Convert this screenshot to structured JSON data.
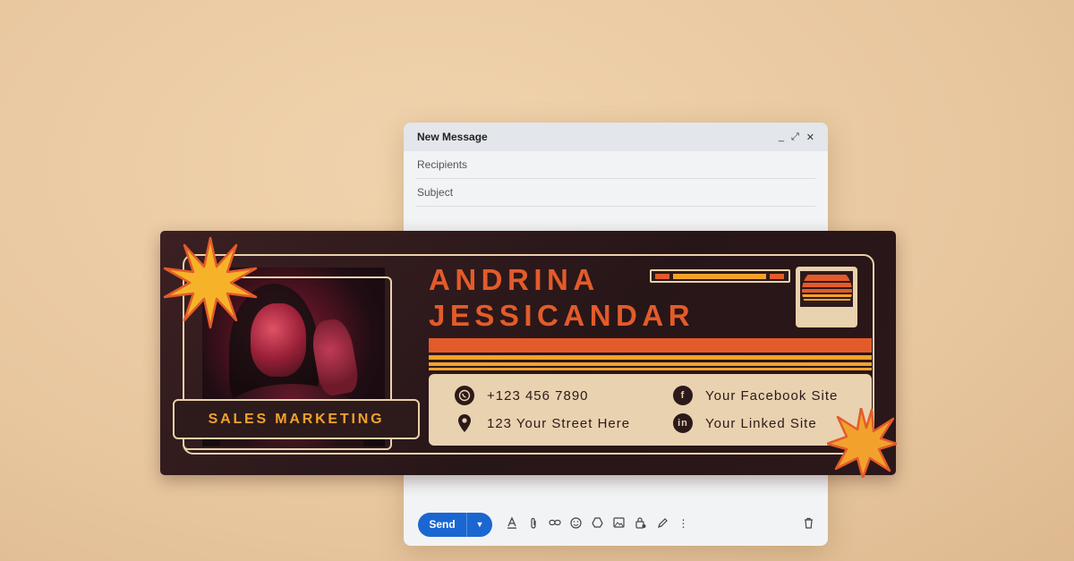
{
  "compose": {
    "title": "New Message",
    "controls": [
      "_",
      "⤢",
      "✕"
    ],
    "recipients_label": "Recipients",
    "subject_label": "Subject",
    "send_label": "Send"
  },
  "signature": {
    "first_name": "ANDRINA",
    "last_name": "JESSICANDAR",
    "job_title": "SALES MARKETING",
    "phone": "+123 456 7890",
    "address": "123 Your Street Here",
    "facebook": "Your Facebook Site",
    "linkedin": "Your Linked Site"
  },
  "colors": {
    "background": "#e9c9a1",
    "banner": "#2b1719",
    "accent_orange": "#e35b2a",
    "accent_gold": "#f2a22c",
    "cream": "#e8d2b0",
    "send_blue": "#1a67d2"
  },
  "icons": {
    "phone": "whatsapp-icon",
    "address": "location-pin-icon",
    "facebook": "facebook-icon",
    "linkedin": "linkedin-icon"
  }
}
